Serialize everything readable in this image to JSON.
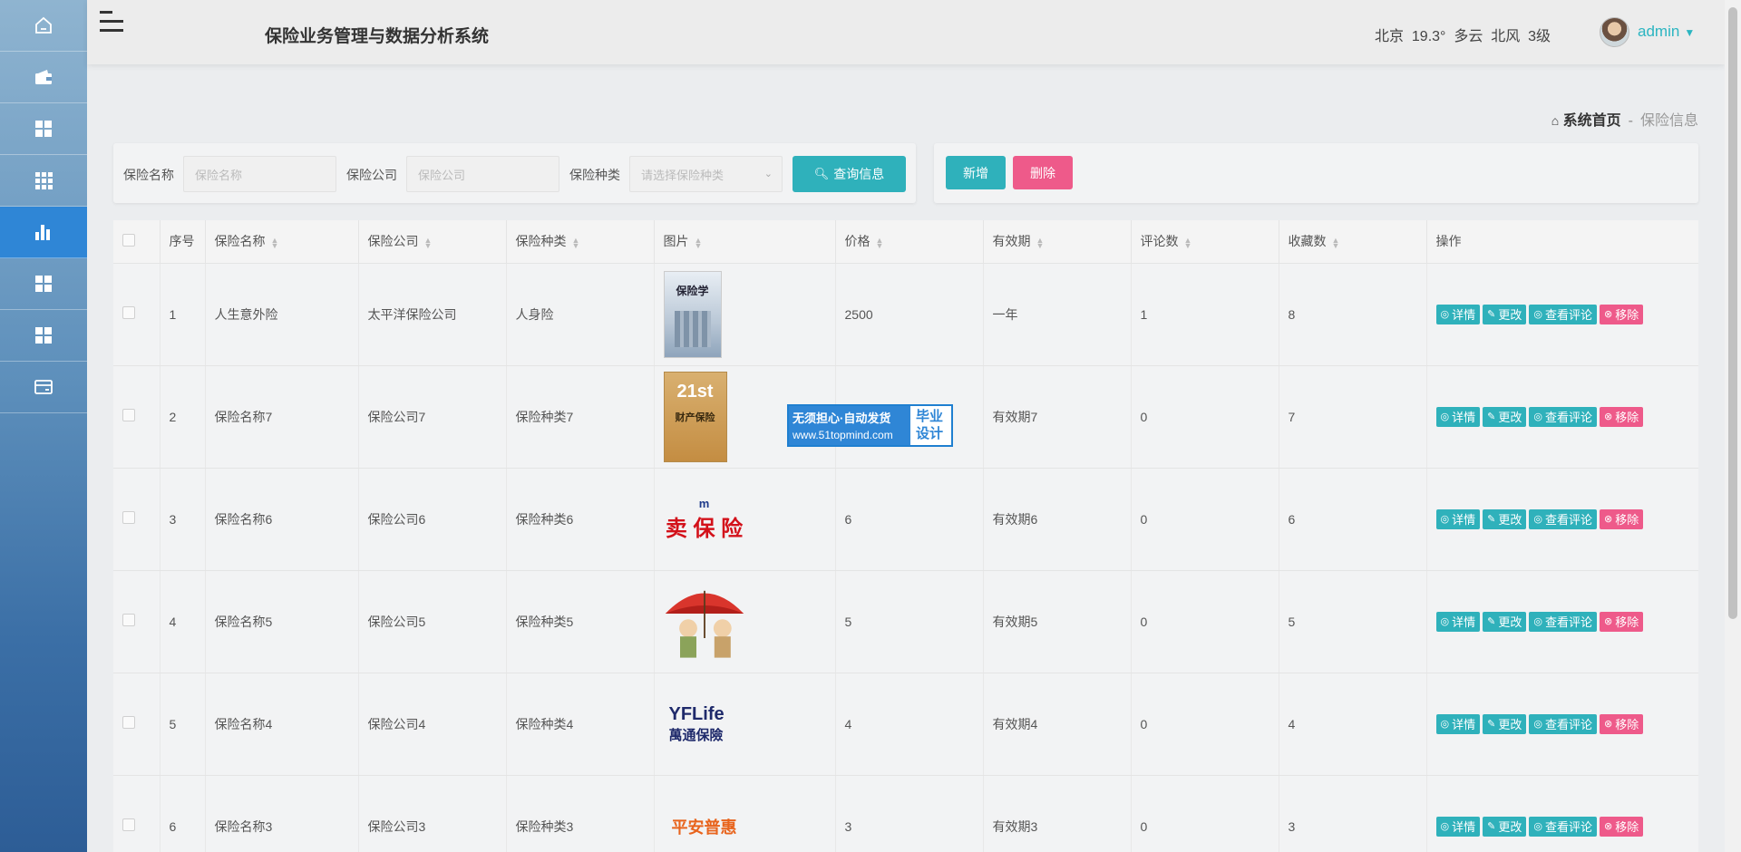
{
  "sidebar": {
    "items": [
      {
        "icon": "home-icon"
      },
      {
        "icon": "wallet-icon"
      },
      {
        "icon": "grid-icon"
      },
      {
        "icon": "apps-icon"
      },
      {
        "icon": "bar-chart-icon",
        "active": true
      },
      {
        "icon": "grid-icon"
      },
      {
        "icon": "grid-icon"
      },
      {
        "icon": "card-icon"
      }
    ]
  },
  "header": {
    "title": "保险业务管理与数据分析系统",
    "weather": "北京  19.3°  多云  北风  3级",
    "user": "admin"
  },
  "breadcrumb": {
    "home": "系统首页",
    "separator": "-",
    "current": "保险信息"
  },
  "search": {
    "name_label": "保险名称",
    "name_placeholder": "保险名称",
    "company_label": "保险公司",
    "company_placeholder": "保险公司",
    "type_label": "保险种类",
    "type_placeholder": "请选择保险种类",
    "query_button": "查询信息"
  },
  "actions": {
    "add": "新增",
    "delete": "删除"
  },
  "table": {
    "columns": [
      "序号",
      "保险名称",
      "保险公司",
      "保险种类",
      "图片",
      "价格",
      "有效期",
      "评论数",
      "收藏数",
      "操作"
    ],
    "rows": [
      {
        "idx": "1",
        "name": "人生意外险",
        "company": "太平洋保险公司",
        "type": "人身险",
        "image": "book-cover-1",
        "price": "2500",
        "validity": "一年",
        "comments": "1",
        "favorites": "8"
      },
      {
        "idx": "2",
        "name": "保险名称7",
        "company": "保险公司7",
        "type": "保险种类7",
        "image": "book-cover-2",
        "price": "",
        "validity": "有效期7",
        "comments": "0",
        "favorites": "7"
      },
      {
        "idx": "3",
        "name": "保险名称6",
        "company": "保险公司6",
        "type": "保险种类6",
        "image": "logo-mai-baoxian",
        "price": "6",
        "validity": "有效期6",
        "comments": "0",
        "favorites": "6"
      },
      {
        "idx": "4",
        "name": "保险名称5",
        "company": "保险公司5",
        "type": "保险种类5",
        "image": "umbrella-cartoon",
        "price": "5",
        "validity": "有效期5",
        "comments": "0",
        "favorites": "5"
      },
      {
        "idx": "5",
        "name": "保险名称4",
        "company": "保险公司4",
        "type": "保险种类4",
        "image": "logo-yflife",
        "price": "4",
        "validity": "有效期4",
        "comments": "0",
        "favorites": "4"
      },
      {
        "idx": "6",
        "name": "保险名称3",
        "company": "保险公司3",
        "type": "保险种类3",
        "image": "logo-pingan",
        "price": "3",
        "validity": "有效期3",
        "comments": "0",
        "favorites": "3"
      }
    ],
    "ops": {
      "detail": "详情",
      "edit": "更改",
      "comments": "查看评论",
      "remove": "移除"
    }
  },
  "images": {
    "book1_title": "保险学",
    "book2_big": "21st",
    "book2_title": "财产保险",
    "logo3_top": "m",
    "logo3_text": "卖 保 险",
    "logo5_en": "YFLife",
    "logo5_cn": "萬通保險",
    "logo6_text": "平安普惠"
  },
  "watermark": {
    "line1": "无须担心·自动发货",
    "line2": "www.51topmind.com",
    "right1": "毕业",
    "right2": "设计"
  }
}
